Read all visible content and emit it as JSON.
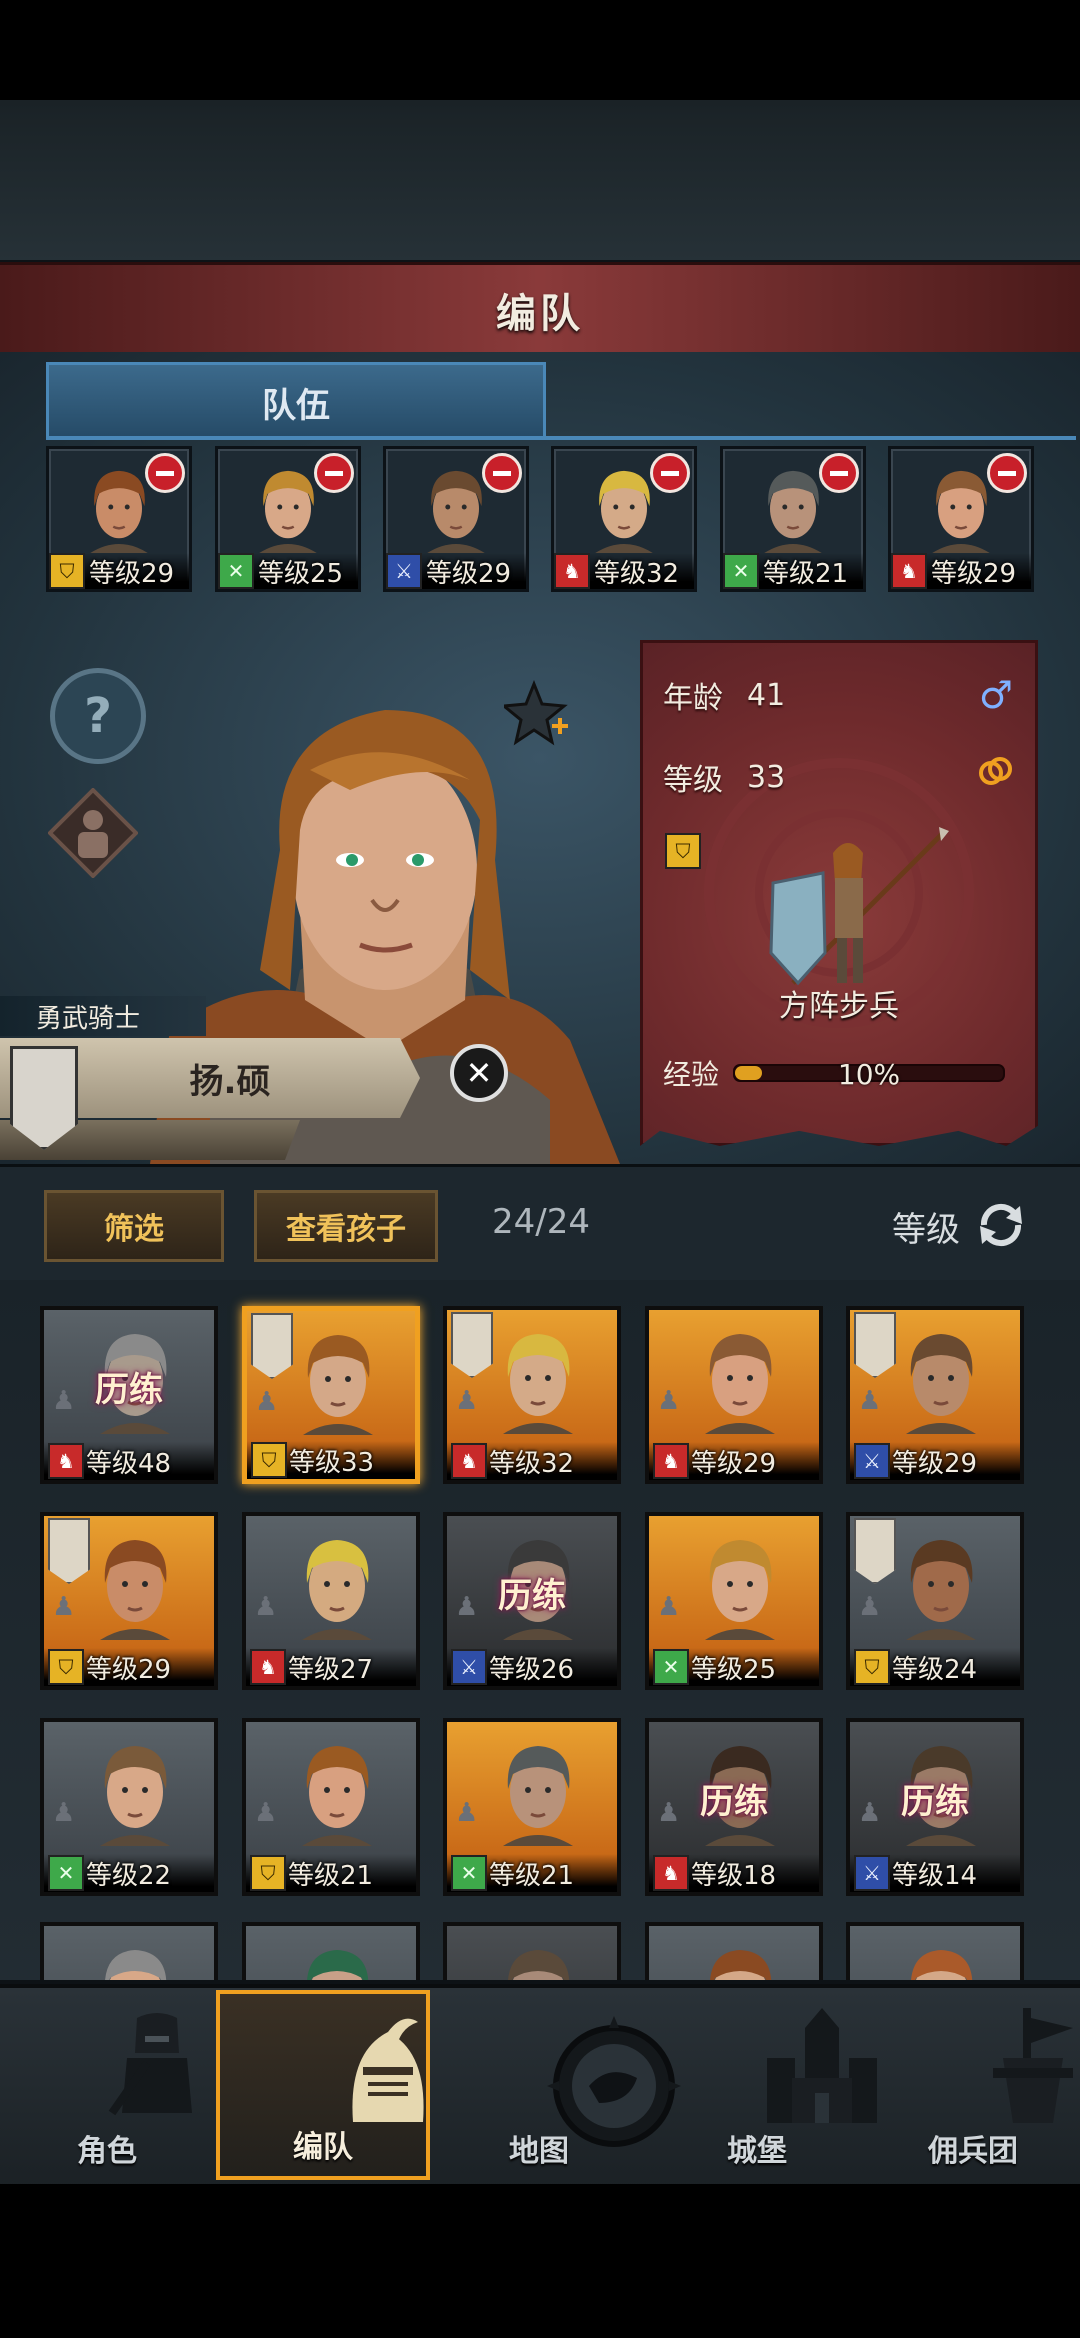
{
  "title": "编队",
  "team_tab": "队伍",
  "party": [
    {
      "role": "shield",
      "level": "等级29",
      "skin": "#c98c68",
      "hair": "#8a4a22"
    },
    {
      "role": "cross",
      "level": "等级25",
      "skin": "#d8a888",
      "hair": "#c08a30"
    },
    {
      "role": "sword",
      "level": "等级29",
      "skin": "#b88a6a",
      "hair": "#6a4a30"
    },
    {
      "role": "horse",
      "level": "等级32",
      "skin": "#d4aa88",
      "hair": "#d8b840"
    },
    {
      "role": "cross",
      "level": "等级21",
      "skin": "#b8927a",
      "hair": "#555a5a"
    },
    {
      "role": "horse",
      "level": "等级29",
      "skin": "#d8a080",
      "hair": "#8a5a34"
    }
  ],
  "hero": {
    "class_title": "勇武骑士",
    "name": "扬.硕",
    "age_label": "年龄",
    "age": "41",
    "level_label": "等级",
    "level": "33",
    "gender_icon": "♂",
    "unit_name": "方阵步兵",
    "exp_label": "经验",
    "exp_percent": "10%",
    "exp_fraction": 0.1
  },
  "filters": {
    "filter_label": "筛选",
    "children_label": "查看孩子",
    "count": "24/24",
    "sort_label": "等级"
  },
  "roster": [
    {
      "bg": "grey",
      "role": "horse",
      "level": "等级48",
      "train": "历练",
      "flag": false,
      "skin": "#a89a8c",
      "hair": "#8a8a8a"
    },
    {
      "bg": "gold",
      "role": "shield",
      "level": "等级33",
      "train": "",
      "flag": true,
      "selected": true,
      "skin": "#d4a888",
      "hair": "#9a5a22"
    },
    {
      "bg": "gold",
      "role": "horse",
      "level": "等级32",
      "train": "",
      "flag": true,
      "skin": "#d4aa88",
      "hair": "#d8b840"
    },
    {
      "bg": "gold",
      "role": "horse",
      "level": "等级29",
      "train": "",
      "flag": false,
      "skin": "#d8a080",
      "hair": "#8a5a34"
    },
    {
      "bg": "gold",
      "role": "sword",
      "level": "等级29",
      "train": "",
      "flag": true,
      "skin": "#b88a6a",
      "hair": "#6a4a30"
    },
    {
      "bg": "gold",
      "role": "shield",
      "level": "等级29",
      "train": "",
      "flag": true,
      "skin": "#c98c68",
      "hair": "#8a4a22"
    },
    {
      "bg": "grey",
      "role": "horse",
      "level": "等级27",
      "train": "",
      "flag": false,
      "skin": "#d4aa80",
      "hair": "#d8c040"
    },
    {
      "bg": "dark",
      "role": "sword",
      "level": "等级26",
      "train": "历练",
      "flag": false,
      "skin": "#a88a78",
      "hair": "#3a3a3a"
    },
    {
      "bg": "gold",
      "role": "cross",
      "level": "等级25",
      "train": "",
      "flag": false,
      "skin": "#d8a888",
      "hair": "#c08a30"
    },
    {
      "bg": "grey",
      "role": "shield",
      "level": "等级24",
      "train": "",
      "flag": true,
      "skin": "#a06a4a",
      "hair": "#5a3a22"
    },
    {
      "bg": "grey",
      "role": "cross",
      "level": "等级22",
      "train": "",
      "flag": false,
      "skin": "#d8a888",
      "hair": "#7a5a3a"
    },
    {
      "bg": "grey",
      "role": "shield",
      "level": "等级21",
      "train": "",
      "flag": false,
      "skin": "#d8a080",
      "hair": "#9a5a22"
    },
    {
      "bg": "gold",
      "role": "cross",
      "level": "等级21",
      "train": "",
      "flag": false,
      "skin": "#b8927a",
      "hair": "#555a5a"
    },
    {
      "bg": "dark",
      "role": "horse",
      "level": "等级18",
      "train": "历练",
      "flag": false,
      "skin": "#8a6a54",
      "hair": "#3a2a20"
    },
    {
      "bg": "dark",
      "role": "sword",
      "level": "等级14",
      "train": "历练",
      "flag": false,
      "skin": "#9a7a66",
      "hair": "#4a3a2a"
    },
    {
      "bg": "grey",
      "role": "",
      "level": "",
      "train": "",
      "flag": false,
      "skin": "#d8a888",
      "hair": "#8a8a8a"
    },
    {
      "bg": "grey",
      "role": "",
      "level": "",
      "train": "",
      "flag": false,
      "skin": "#c8a088",
      "hair": "#2a6a4a"
    },
    {
      "bg": "dark",
      "role": "",
      "level": "",
      "train": "",
      "flag": false,
      "skin": "#a88a78",
      "hair": "#5a4a3a"
    },
    {
      "bg": "grey",
      "role": "",
      "level": "",
      "train": "",
      "flag": false,
      "skin": "#d4a888",
      "hair": "#8a4a22"
    },
    {
      "bg": "grey",
      "role": "",
      "level": "",
      "train": "",
      "flag": false,
      "skin": "#d4a888",
      "hair": "#aa5a2a"
    }
  ],
  "nav": [
    {
      "label": "角色",
      "icon": "knight-icon"
    },
    {
      "label": "编队",
      "icon": "helmet-icon",
      "active": true
    },
    {
      "label": "地图",
      "icon": "compass-map-icon"
    },
    {
      "label": "城堡",
      "icon": "castle-icon"
    },
    {
      "label": "佣兵团",
      "icon": "mercenary-icon"
    }
  ],
  "colors": {
    "accent": "#f0a020",
    "title_banner": "#8a3a3a",
    "tab": "#4a88b8",
    "stats_card": "#6e2a2c"
  }
}
